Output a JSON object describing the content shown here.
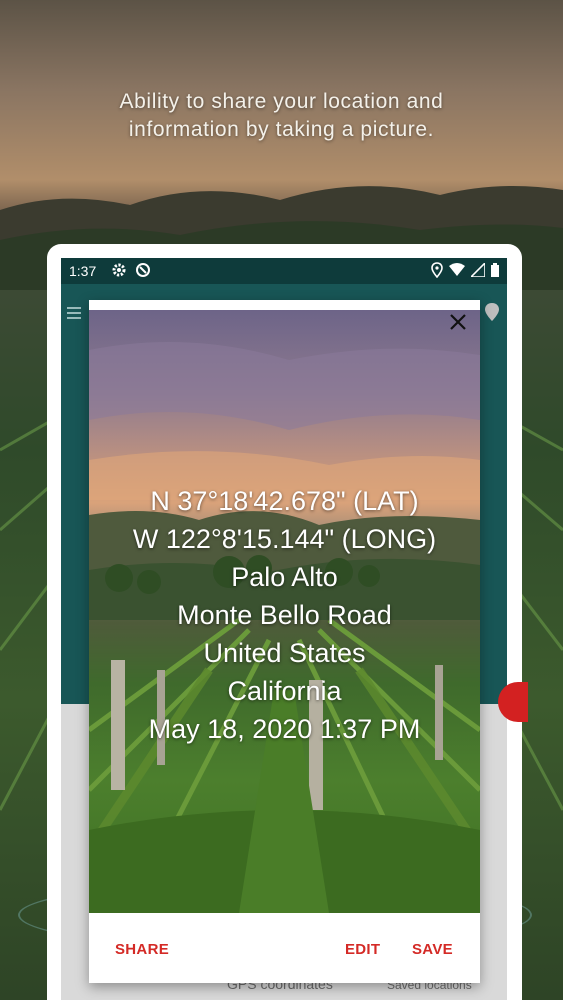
{
  "promo": {
    "line1": "Ability to share your location and",
    "line2": "information by taking a picture."
  },
  "statusbar": {
    "time": "1:37",
    "icons": [
      "settings-icon",
      "data-saver-icon",
      "location-icon",
      "wifi-icon",
      "signal-icon",
      "battery-icon"
    ]
  },
  "dialog": {
    "photo_text": {
      "latitude": "N 37°18'42.678\" (LAT)",
      "longitude": "W 122°8'15.144\" (LONG)",
      "city": "Palo Alto",
      "street": "Monte Bello Road",
      "country": "United States",
      "state": "California",
      "datetime": "May 18, 2020 1:37 PM"
    },
    "actions": {
      "share": "SHARE",
      "edit": "EDIT",
      "save": "SAVE"
    }
  },
  "bottom_nav": {
    "gps": "GPS coordinates",
    "saved": "Saved locations"
  },
  "colors": {
    "accent": "#d42a26",
    "appbar": "#185656",
    "statusbar": "#0e3b3b"
  }
}
